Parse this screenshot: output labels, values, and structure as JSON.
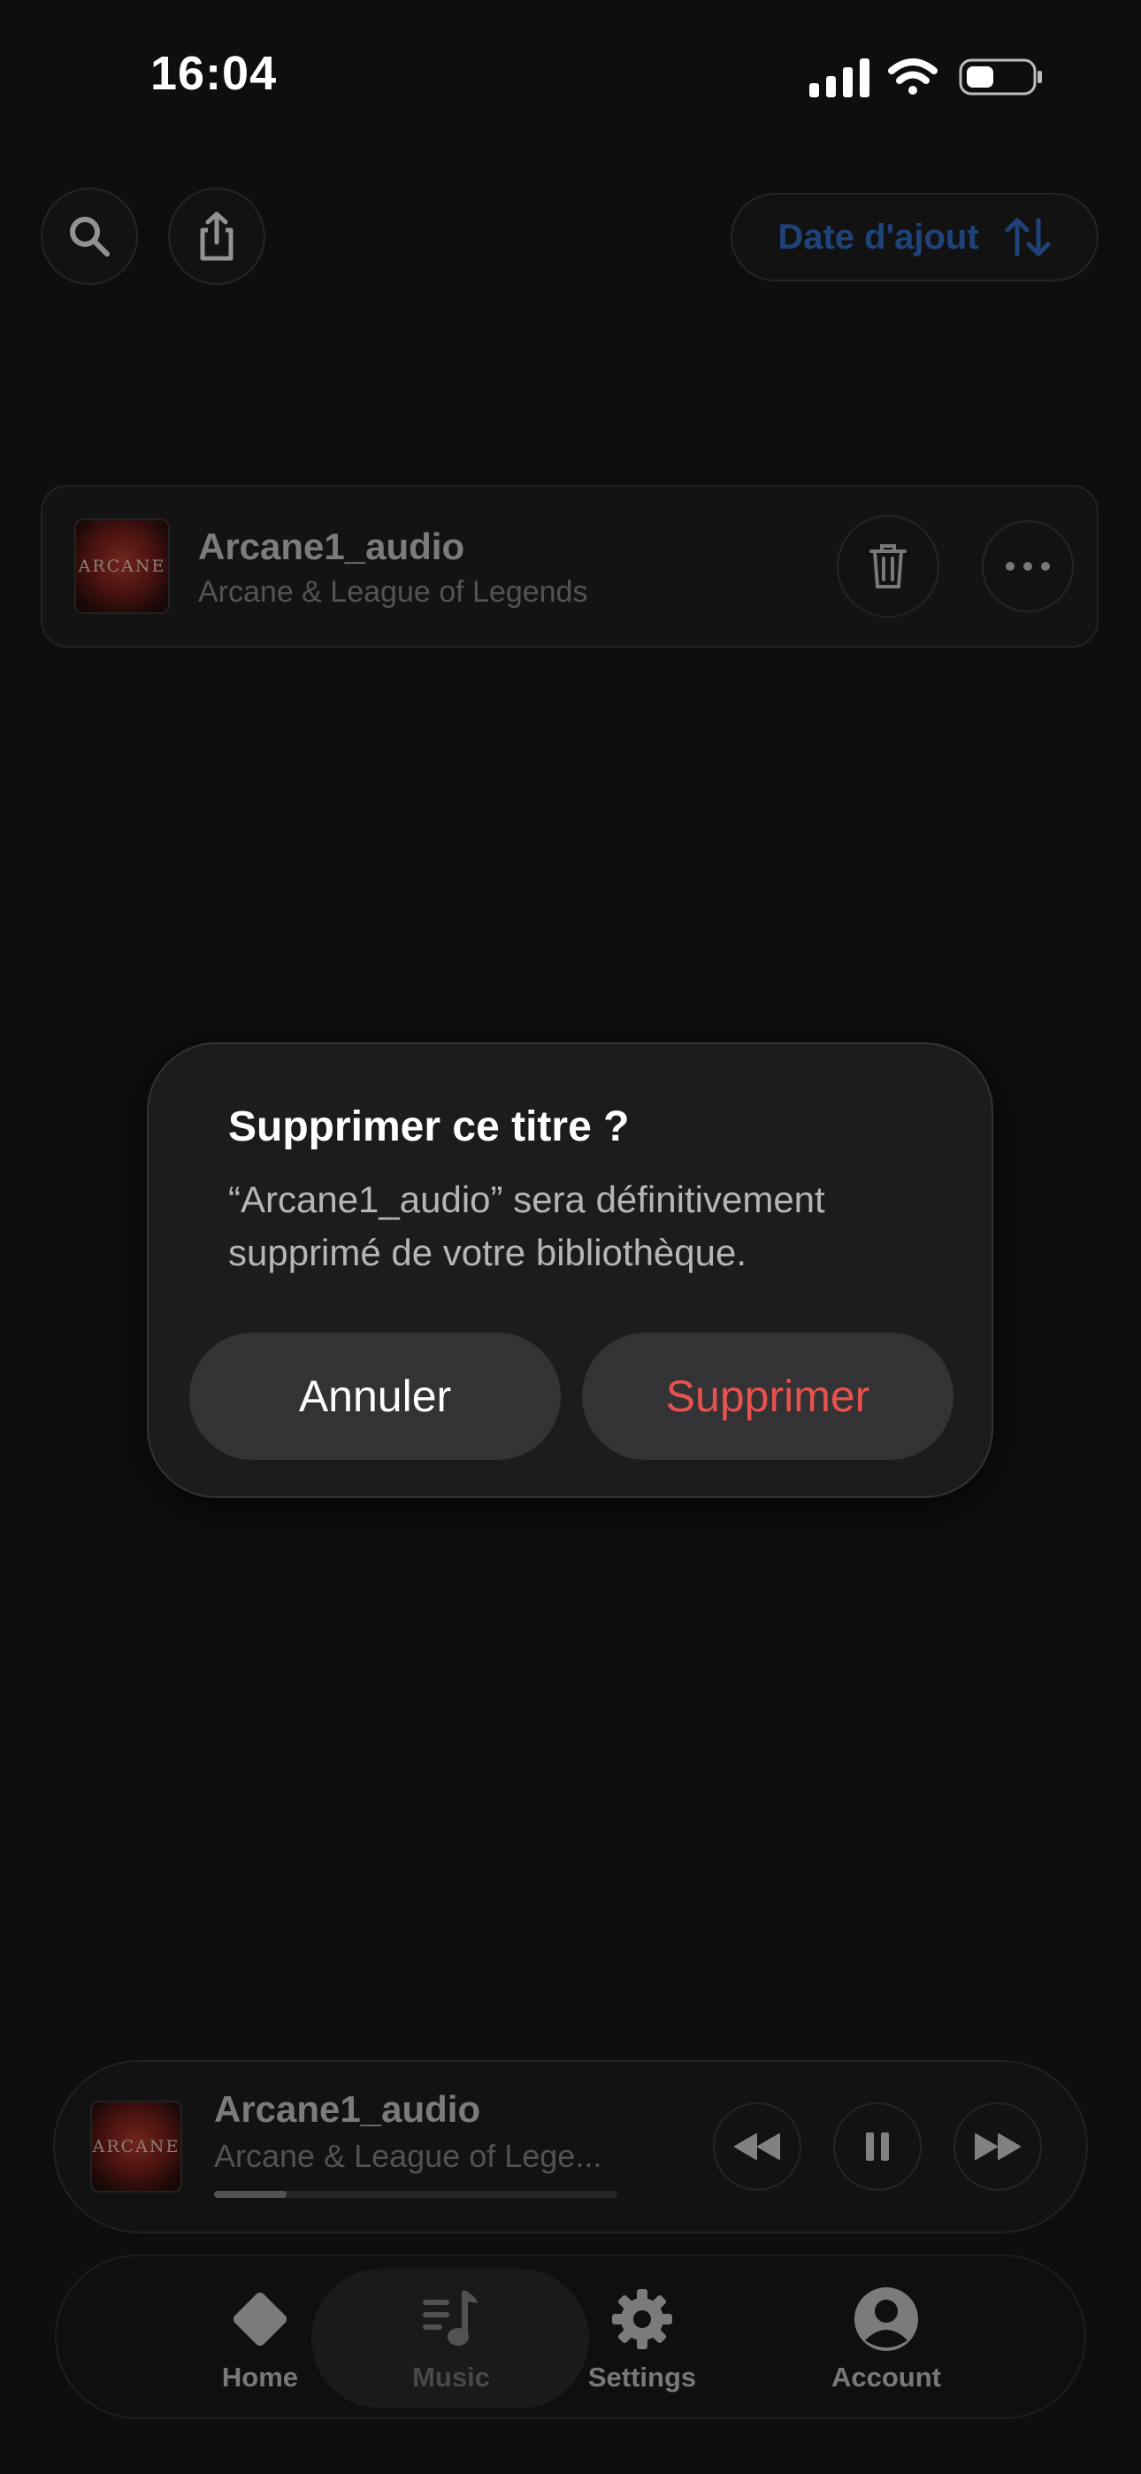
{
  "status_bar": {
    "time": "16:04"
  },
  "toolbar": {
    "sort_label": "Date d'ajout"
  },
  "track": {
    "cover_text": "ARCANE",
    "title": "Arcane1_audio",
    "artist": "Arcane & League of Legends"
  },
  "dialog": {
    "title": "Supprimer ce titre ?",
    "message": "“Arcane1_audio” sera définitivement supprimé de votre bibliothèque.",
    "cancel_label": "Annuler",
    "confirm_label": "Supprimer"
  },
  "player": {
    "cover_text": "ARCANE",
    "title": "Arcane1_audio",
    "artist": "Arcane & League of Lege...",
    "progress": 0.18
  },
  "tabs": [
    {
      "label": "Home",
      "icon": "diamond-icon"
    },
    {
      "label": "Music",
      "icon": "music-library-icon"
    },
    {
      "label": "Settings",
      "icon": "gear-icon"
    },
    {
      "label": "Account",
      "icon": "account-icon"
    }
  ],
  "colors": {
    "accent": "#2f6fd1",
    "destructive": "#e8524e",
    "background": "#0e0e0e"
  }
}
